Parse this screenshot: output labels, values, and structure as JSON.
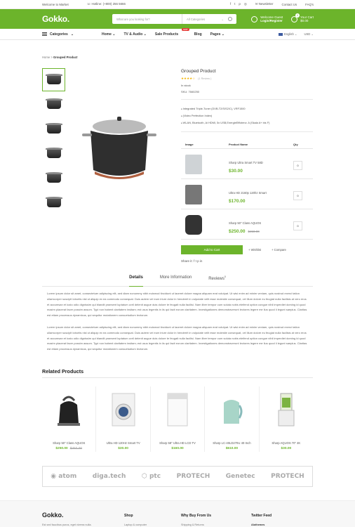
{
  "topbar": {
    "welcome": "Welcome to Market",
    "hotline": "Hotline: (+800) 256 5666",
    "newsletter": "Newsletter",
    "contact": "Contact Us",
    "faq": "FAQ's"
  },
  "header": {
    "logo": "Gokko.",
    "search_placeholder": "What are you looking for?",
    "category": "All Categories",
    "welcome": "Welcome Guest",
    "login": "Login/Register",
    "cart_label": "Your Cart",
    "cart_total": "$0.00",
    "cart_count": "0"
  },
  "nav": {
    "categories": "Categories",
    "items": [
      "Home",
      "TV & Audio",
      "Sale Products",
      "Blog",
      "Pages"
    ],
    "hot": "HOT",
    "language": "English",
    "currency": "USD"
  },
  "breadcrumb": {
    "home": "Home",
    "current": "Grouped Product"
  },
  "product": {
    "title": "Grouped Product",
    "stars": "★★★★☆",
    "reviews": "(1 Review )",
    "stock": "In stock",
    "sku": "SKU: 7660250",
    "features": [
      "Integrated Triple-Tuner (DVB-T2/S/S2/C), VRF1500",
      "(Video Perfection Index)",
      "WLAN, Bluetooth, Ai HDMI, 5x USB,EnergieEffizienz: A (Skala A+ bis F)"
    ]
  },
  "table": {
    "headers": [
      "Image",
      "Product Name",
      "Qty"
    ],
    "rows": [
      {
        "name": "Sharp Ultra Smart TV 58D",
        "price": "$30.00",
        "old": "",
        "qty": "0"
      },
      {
        "name": "Ultra HD 2160p 120hz Smart",
        "price": "$170.00",
        "old": "",
        "qty": "0"
      },
      {
        "name": "Sharp 50\" Class AQUOS",
        "price": "$250.00",
        "old": "$450.00",
        "qty": "0"
      }
    ]
  },
  "actions": {
    "add_to_cart": "Add to Cart",
    "wishlist": "+ Wishlist",
    "compare": "+ Compare",
    "share": "Share it:"
  },
  "tabs": [
    "Details",
    "More Information",
    "Reviews"
  ],
  "reviews_count": "0",
  "description": [
    "Lorem ipsum dolor sit amet, consectetuer adipiscing elit, sed diam nonummy nibh euismod tincidunt ut laoreet dolore magna aliquam erat volutpat. Ut wisi enim ad minim veniam, quis nostrud exerci tation ullamcorper suscipit lobortis nisl ut aliquip ex ea commodo consequat. Duis autem vel eum iriure dolor in hendrerit in vulputate velit esse molestie consequat, vel illum dolore eu feugiat nulla facilisis at vero eros et accumsan et iusto odio dignissim qui blandit praesent luptatum zzril delenit augue duis dolore te feugait nulla facilisi. Nam liber tempor cum soluta nobis eleifend option congue nihil imperdiet doming id quod mazim placerat facer possim assum. Typi non habent claritatem insitam; est usus legentis in iis qui facit eorum claritatem. Investigationes demonstraverunt lectores legere me lius quod ii legunt saepius. Claritas est etiam processus dynamicus, qui sequitur mutationem consuetudium lectorum.",
    "Lorem ipsum dolor sit amet, consectetuer adipiscing elit, sed diam nonummy nibh euismod tincidunt ut laoreet dolore magna aliquam erat volutpat. Ut wisi enim ad minim veniam, quis nostrud exerci tation ullamcorper suscipit lobortis nisl ut aliquip ex ea commodo consequat. Duis autem vel eum iriure dolor in hendrerit in vulputate velit esse molestie consequat, vel illum dolore eu feugiat nulla facilisis at vero eros et accumsan et iusto odio dignissim qui blandit praesent luptatum zzril delenit augue duis dolore te feugait nulla facilisi. Nam liber tempor cum soluta nobis eleifend option congue nihil imperdiet doming id quod mazim placerat facer possim assum. Typi non habent claritatem insitam; est usus legentis in iis qui facit eorum claritatem. Investigationes demonstraverunt lectores legere me lius quod ii legunt saepius. Claritas est etiam processus dynamicus, qui sequitur mutationem consuetudium lectorum."
  ],
  "related": {
    "title": "Related Products",
    "items": [
      {
        "name": "Sharp 50\" Class AQUOS",
        "price": "$250.00",
        "old": "$450.00"
      },
      {
        "name": "Ultra HD 120Hz Smart TV",
        "price": "$30.00",
        "old": ""
      },
      {
        "name": "Sharp 58\" Ultra HD LCD TV",
        "price": "$160.00",
        "old": ""
      },
      {
        "name": "Sharp LC-40LD270U 40-Inch",
        "price": "$610.00",
        "old": ""
      },
      {
        "name": "Sharp AQUOS 70\" 4K",
        "price": "$30.00",
        "old": ""
      }
    ]
  },
  "brands": [
    "atom",
    "diga.tech",
    "ptc",
    "PROTECH",
    "Genetec",
    "PROTECH"
  ],
  "footer": {
    "logo": "Gokko.",
    "tagline": "Est sed faucibus purus, eget viverra nulla.",
    "cols": [
      "Shop",
      "Why Buy From Us",
      "Twitter Feed"
    ],
    "subs": [
      "Laptop & computer",
      "Shipping & Returns",
      "Alothemes"
    ]
  }
}
